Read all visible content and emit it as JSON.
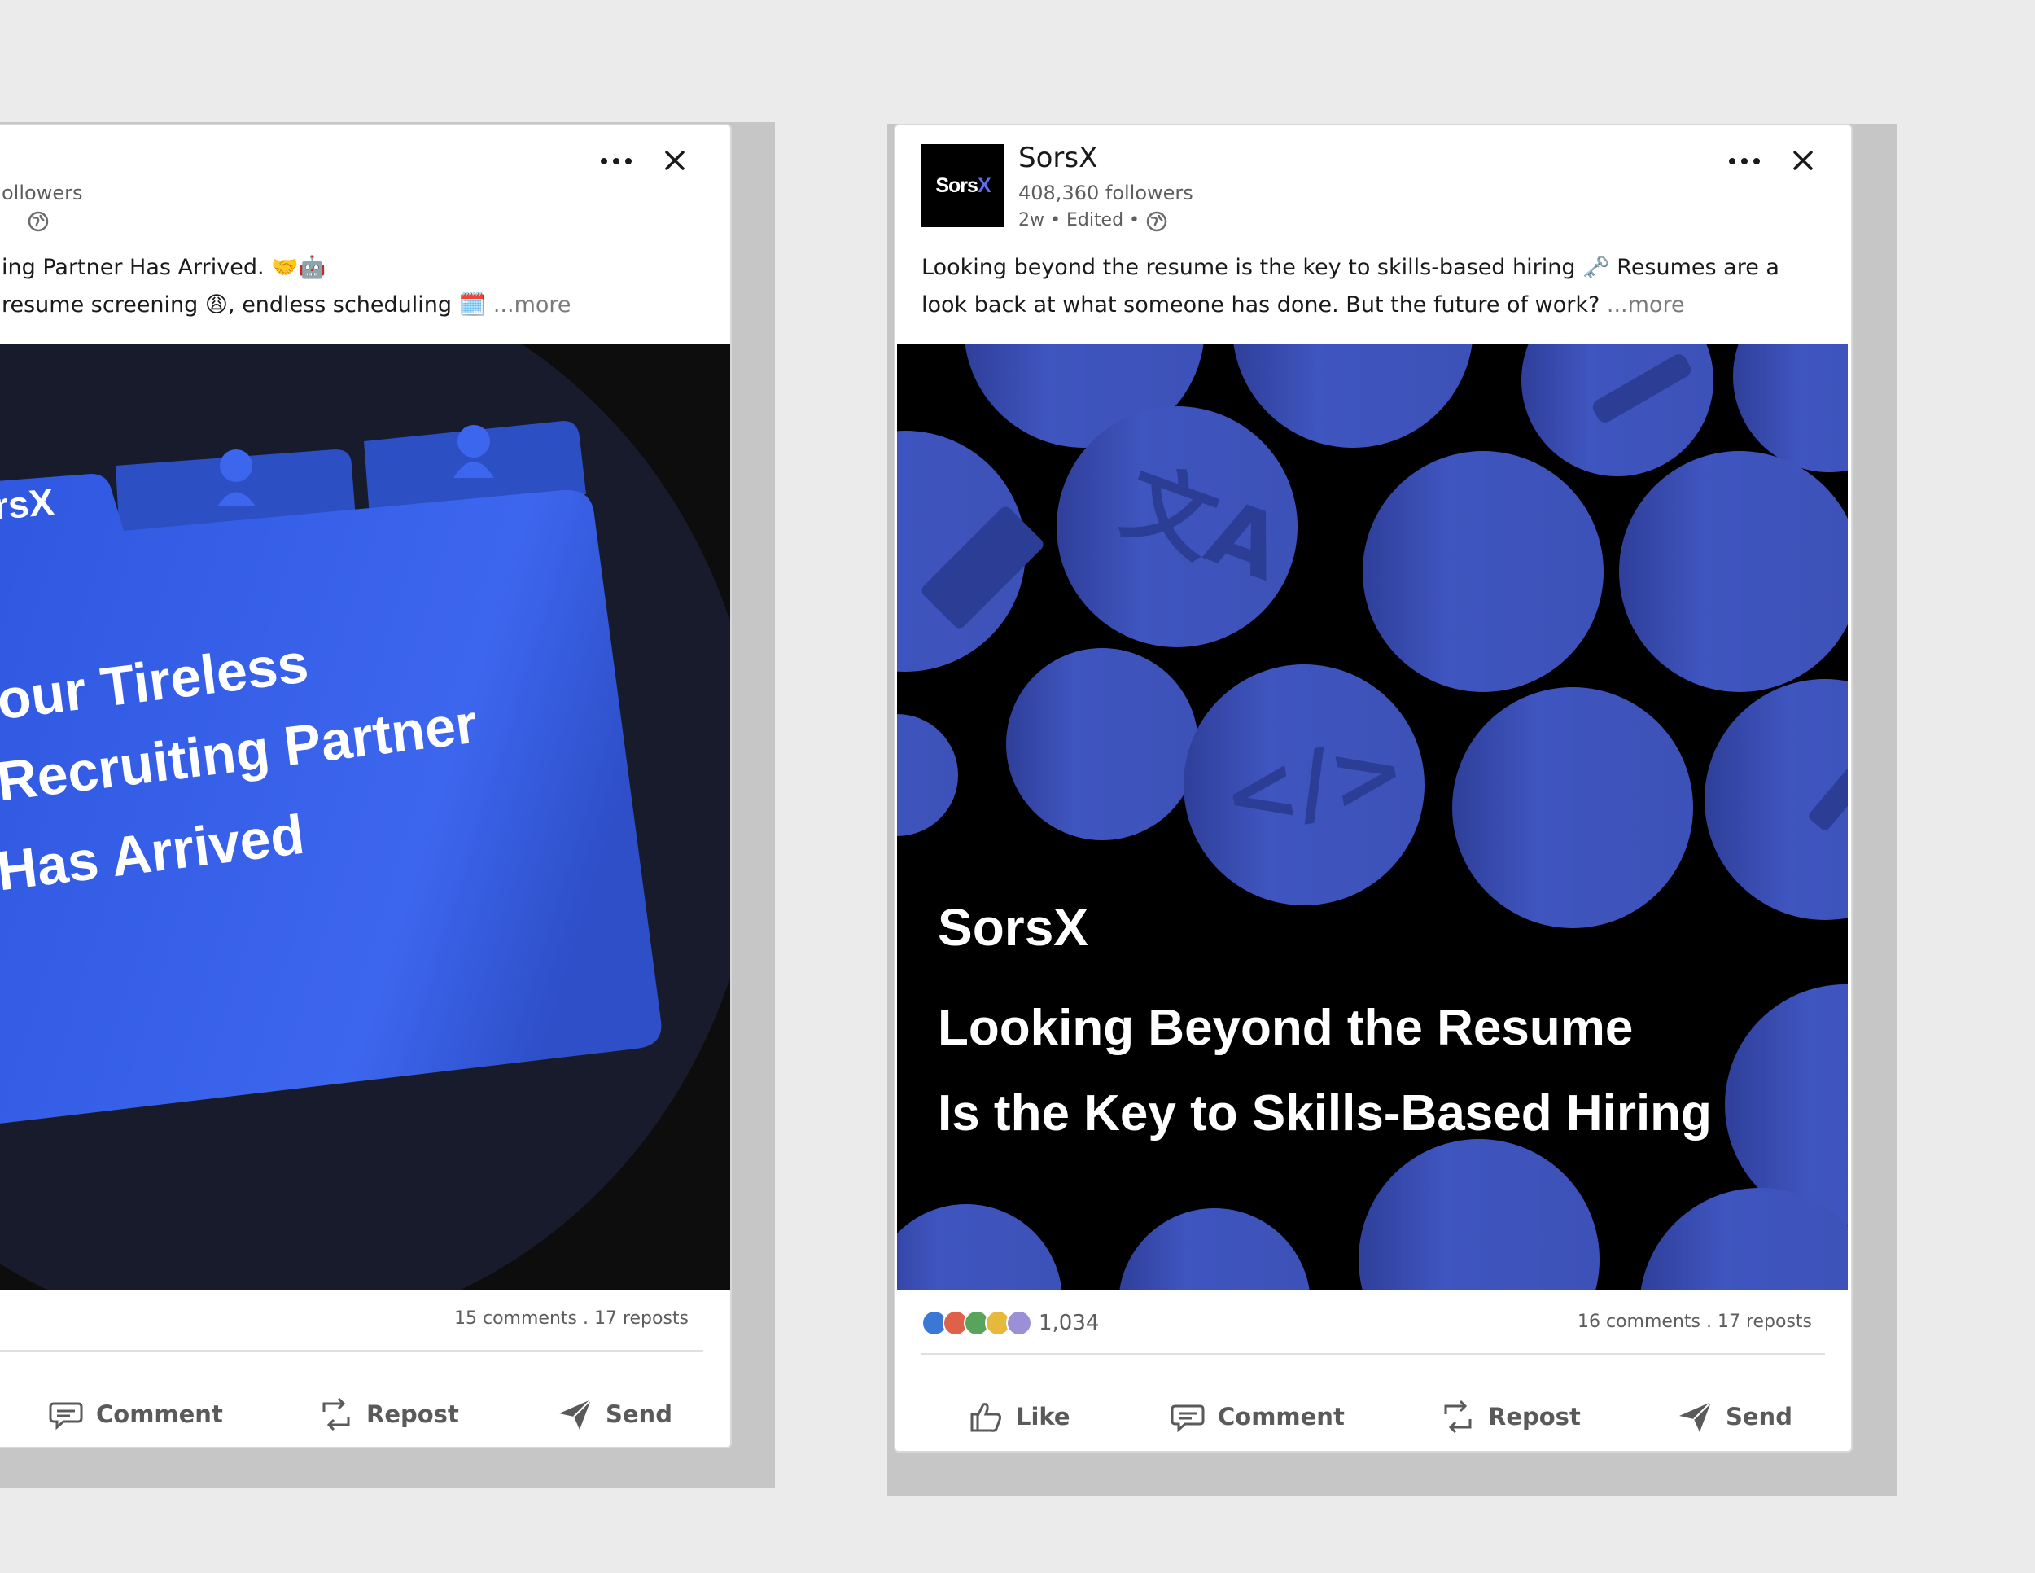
{
  "left_post": {
    "followers_fragment": "ollowers",
    "text_line1": "ing Partner Has Arrived. 🤝🤖",
    "text_line2": "resume screening 😩, endless scheduling 🗓️",
    "more_label": "...more",
    "image": {
      "brand_fragment": "rsX",
      "headline_lines": [
        "our Tireless",
        "Recruiting Partner",
        "Has Arrived"
      ]
    },
    "stats": "15 comments . 17 reposts",
    "actions": {
      "comment": "Comment",
      "repost": "Repost",
      "send": "Send"
    }
  },
  "right_post": {
    "logo_text": "Sors",
    "logo_x": "X",
    "name": "SorsX",
    "followers": "408,360 followers",
    "meta": "2w • Edited •",
    "text_line1": "Looking beyond the resume is the key to skills-based hiring 🗝️ Resumes are a",
    "text_line2": "look back at what someone has done. But the future of work?",
    "more_label": "...more",
    "image": {
      "brand": "SorsX",
      "headline_line1": "Looking Beyond the Resume",
      "headline_line2": "Is the Key to Skills-Based Hiring"
    },
    "reaction_count": "1,034",
    "stats": "16 comments . 17 reposts",
    "actions": {
      "like": "Like",
      "comment": "Comment",
      "repost": "Repost",
      "send": "Send"
    }
  },
  "colors": {
    "brand_blue": "#3e5fe6",
    "circle_blue": "#3d52b8",
    "image_dark": "#15192a"
  },
  "icons": [
    "more-options-icon",
    "close-icon",
    "globe-icon",
    "comment-icon",
    "repost-icon",
    "send-icon",
    "like-icon"
  ]
}
